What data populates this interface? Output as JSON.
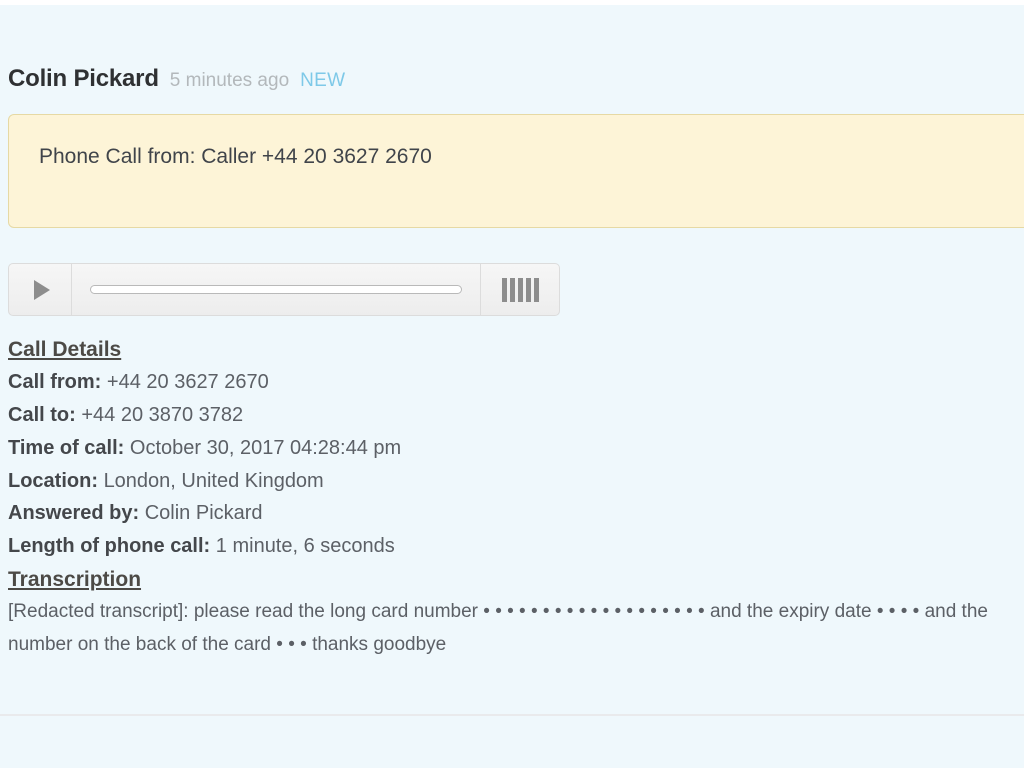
{
  "message": {
    "sender": "Colin Pickard",
    "time_ago": "5 minutes ago",
    "badge": "NEW"
  },
  "notice": {
    "text": "Phone Call from: Caller +44 20 3627 2670"
  },
  "player": {
    "play_label": "▶",
    "progress_percent": 0,
    "volume_icon": "equalizer-bars"
  },
  "call_details": {
    "heading": "Call Details",
    "rows": [
      {
        "label": "Call from:",
        "value": "+44 20 3627 2670"
      },
      {
        "label": "Call to:",
        "value": "+44 20 3870 3782"
      },
      {
        "label": "Time of call:",
        "value": "October 30, 2017 04:28:44 pm"
      },
      {
        "label": "Location:",
        "value": "London, United Kingdom"
      },
      {
        "label": "Answered by:",
        "value": "Colin Pickard"
      },
      {
        "label": "Length of phone call:",
        "value": "1 minute, 6 seconds"
      }
    ]
  },
  "transcription": {
    "heading": "Transcription",
    "text": "[Redacted transcript]: please read the long card number • • • • • • • • • • • • • • • • • • • and the expiry date • • • • and the number on the back of the card • • • thanks goodbye"
  },
  "colors": {
    "page_background": "#eff8fc",
    "notice_background": "#fdf4d7",
    "notice_border": "#e6d9a4",
    "badge": "#7ec9e8",
    "text": "#5c6066",
    "divider": "#e9eaec"
  }
}
